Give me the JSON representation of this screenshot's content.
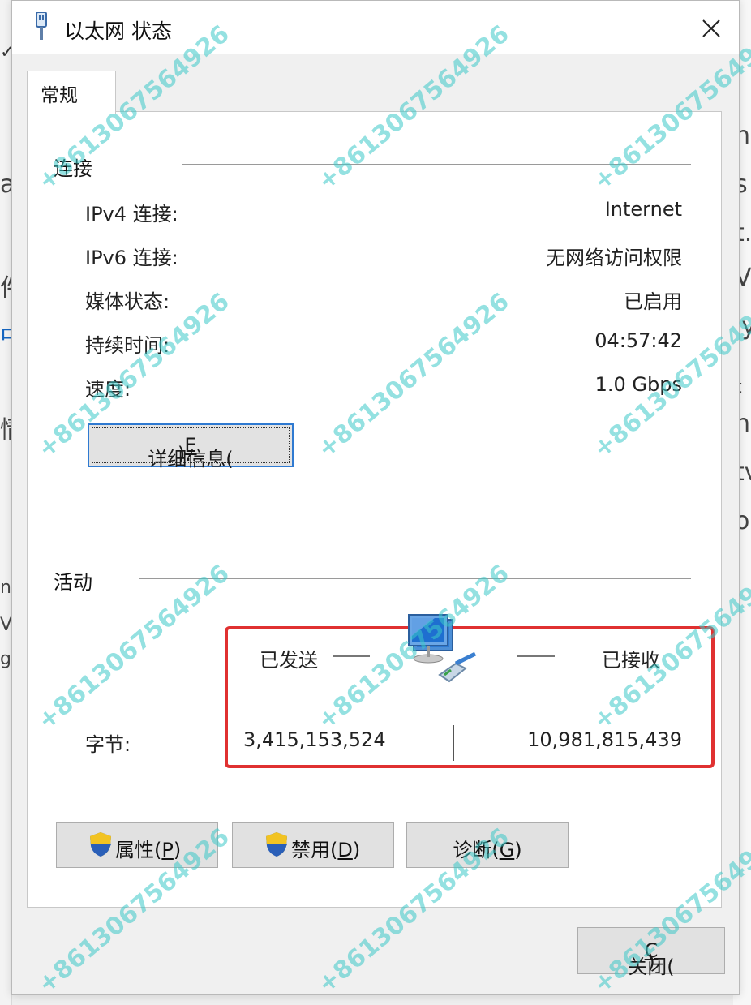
{
  "window": {
    "title": "以太网 状态",
    "close_symbol": "✕",
    "close_icon": "close-icon"
  },
  "tabs": [
    {
      "label": "常规",
      "selected": true
    }
  ],
  "connection": {
    "group_label": "连接",
    "rows": [
      {
        "label": "IPv4 连接:",
        "value": "Internet"
      },
      {
        "label": "IPv6 连接:",
        "value": "无网络访问权限"
      },
      {
        "label": "媒体状态:",
        "value": "已启用"
      },
      {
        "label": "持续时间:",
        "value": "04:57:42"
      },
      {
        "label": "速度:",
        "value": "1.0 Gbps"
      }
    ],
    "details_button": {
      "text": "详细信息(",
      "mnemonic": "E",
      "suffix": ")..."
    }
  },
  "activity": {
    "group_label": "活动",
    "sent_label": "已发送",
    "received_label": "已接收",
    "bytes_label": "字节:",
    "bytes_sent": "3,415,153,524",
    "bytes_received": "10,981,815,439",
    "icon": "network-computer-icon",
    "highlight_color": "#e03131"
  },
  "buttons": {
    "properties": {
      "text": "属性(",
      "mnemonic": "P",
      "suffix": ")",
      "icon": "uac-shield-icon"
    },
    "disable": {
      "text": "禁用(",
      "mnemonic": "D",
      "suffix": ")",
      "icon": "uac-shield-icon"
    },
    "diagnose": {
      "text": "诊断(",
      "mnemonic": "G",
      "suffix": ")"
    },
    "close": {
      "text": "关闭(",
      "mnemonic": "C",
      "suffix": ")"
    }
  },
  "background": {
    "right_glyphs": [
      "n",
      "s",
      "t.",
      "V",
      "ly",
      ": t",
      "h",
      "tv",
      "o"
    ],
    "left_glyphs": [
      "a",
      "件",
      "中",
      "情",
      "n3",
      "V",
      "g"
    ]
  },
  "watermark": {
    "text": "+8613067564926",
    "color": "#3cc8c8"
  }
}
